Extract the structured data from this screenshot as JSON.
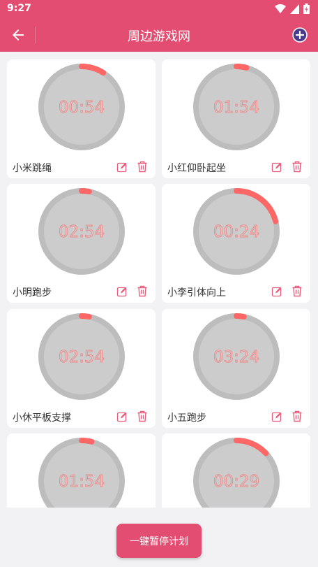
{
  "status": {
    "time": "9:27"
  },
  "appbar": {
    "title": "周边游戏网"
  },
  "colors": {
    "brand": "#e34d72",
    "ring": "#bdbdbd",
    "dial": "#cccccc",
    "progress": "#ff6666"
  },
  "timers": [
    {
      "time": "00:54",
      "name": "小米跳绳",
      "progress": 0.09
    },
    {
      "time": "01:54",
      "name": "小红仰卧起坐",
      "progress": 0.04
    },
    {
      "time": "02:54",
      "name": "小明跑步",
      "progress": 0.03
    },
    {
      "time": "00:24",
      "name": "小李引体向上",
      "progress": 0.21
    },
    {
      "time": "02:54",
      "name": "小休平板支撑",
      "progress": 0.03
    },
    {
      "time": "03:24",
      "name": "小五跑步",
      "progress": 0.03
    },
    {
      "time": "01:54",
      "name": "",
      "progress": 0.04
    },
    {
      "time": "00:29",
      "name": "",
      "progress": 0.13
    }
  ],
  "bottom": {
    "pause_all_label": "一键暂停计划"
  }
}
